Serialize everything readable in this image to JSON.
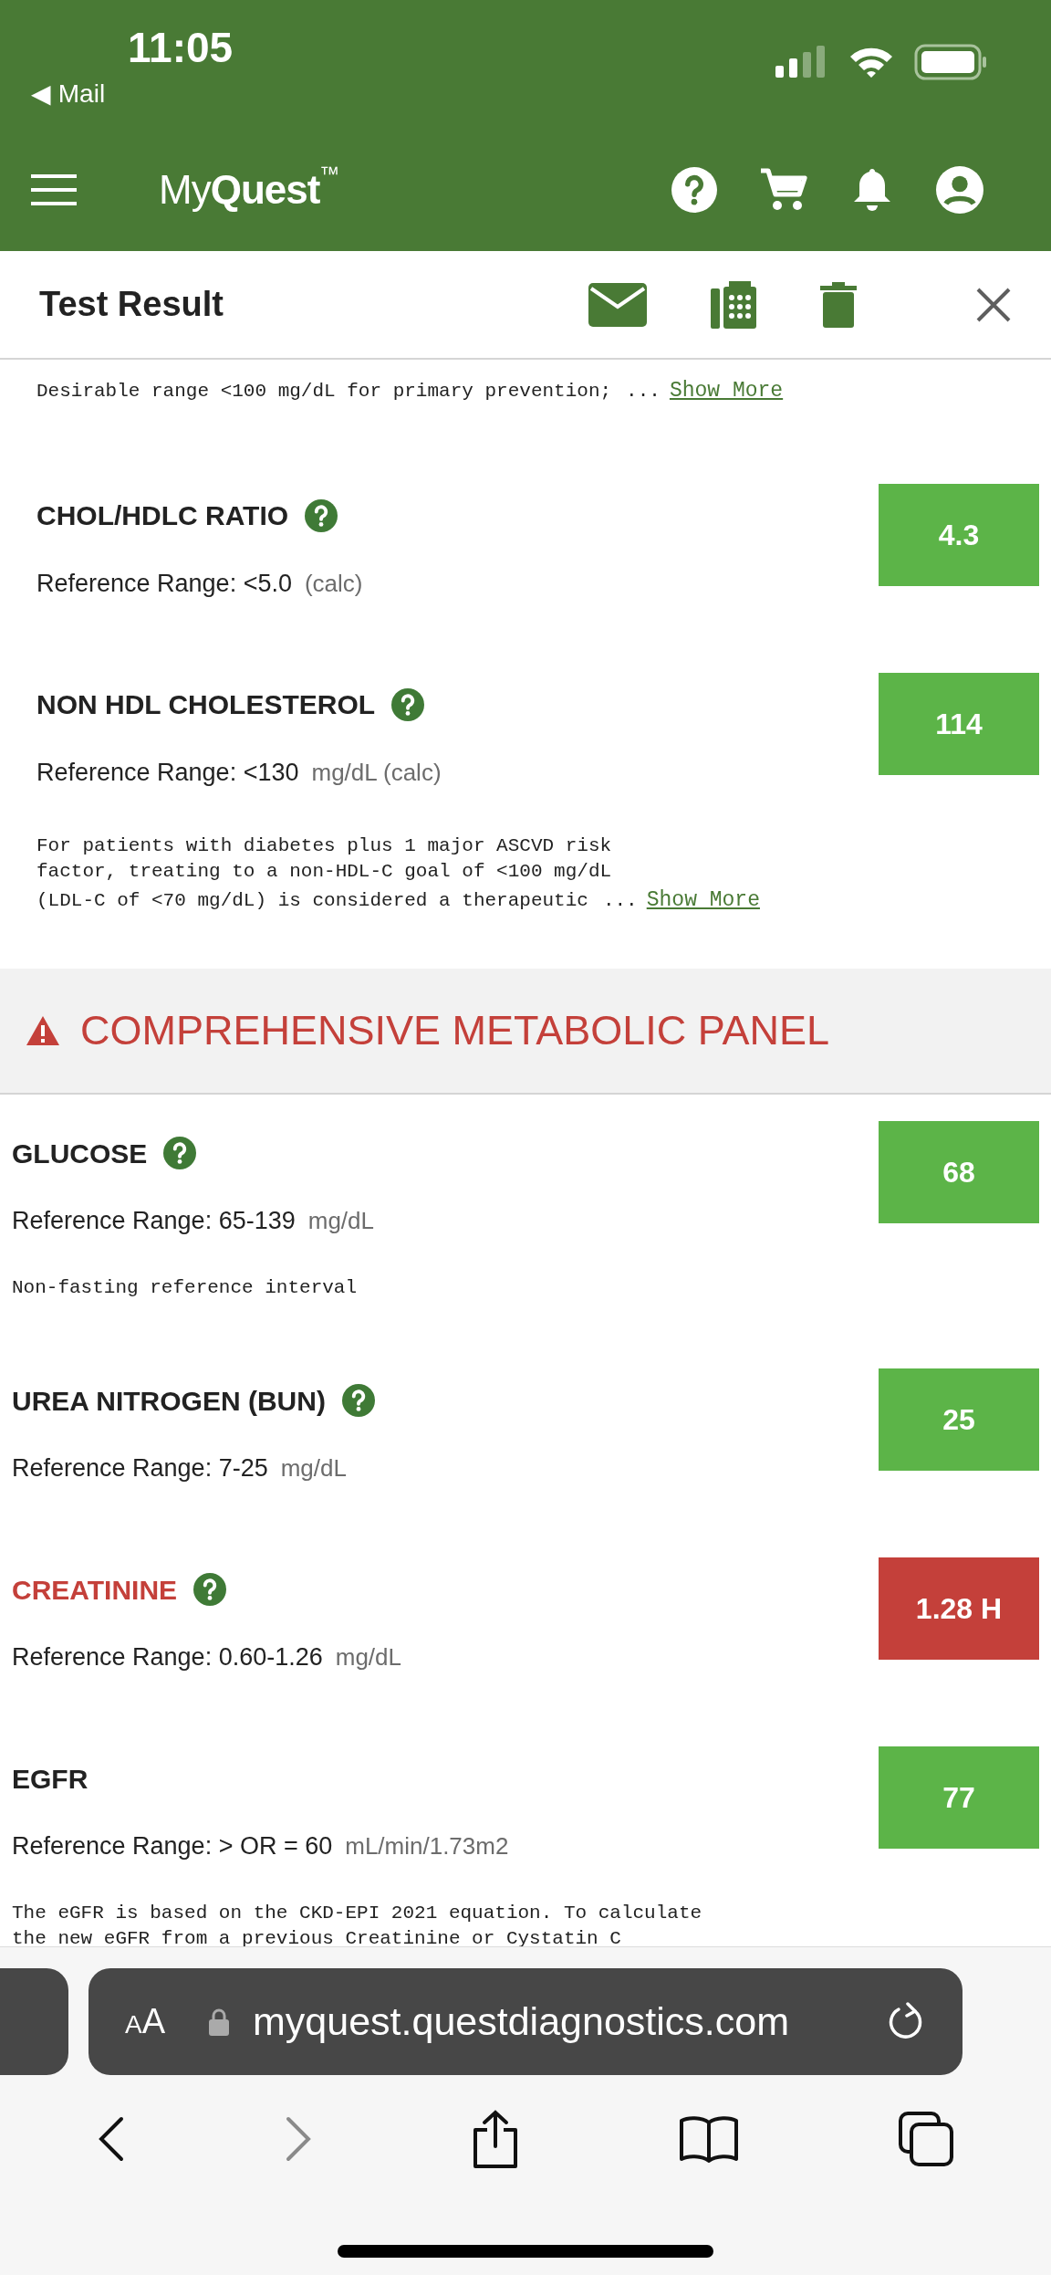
{
  "status_bar": {
    "time": "11:05",
    "back_app": "◀ Mail"
  },
  "app_header": {
    "logo": "My**Quest**$^{™}$"
  },
  "title_bar": {
    "title": "Test Result"
  },
  "sections": [
    {
      "intro_note": {
        "text": "Desirable range <100 mg/dL for primary prevention;",
        "ellipsis": "...",
        "link": "Show More"
      },
      "results": [
        {
          "name": "CHOL/HDLC RATIO",
          "help": true,
          "abnormal": false,
          "value": "4.3",
          "reference": "Reference Range: <5.0",
          "units": "(calc)"
        },
        {
          "name": "NON HDL CHOLESTEROL",
          "help": true,
          "abnormal": false,
          "value": "114",
          "reference": "Reference Range: <130",
          "units": "mg/dL (calc)",
          "note": {
            "text": "For patients with diabetes plus 1 major ASCVD risk\nfactor, treating to a non-HDL-C goal of <100 mg/dL\n(LDL-C of <70 mg/dL) is considered a therapeutic",
            "ellipsis": "...",
            "link": "Show More"
          }
        }
      ]
    },
    {
      "heading": "COMPREHENSIVE METABOLIC PANEL",
      "warning": true,
      "results": [
        {
          "name": "GLUCOSE",
          "help": true,
          "abnormal": false,
          "value": "68",
          "reference": "Reference Range: 65-139",
          "units": "mg/dL",
          "note": {
            "text": "Non-fasting reference interval"
          }
        },
        {
          "name": "UREA NITROGEN (BUN)",
          "help": true,
          "abnormal": false,
          "value": "25",
          "reference": "Reference Range: 7-25",
          "units": "mg/dL"
        },
        {
          "name": "CREATININE",
          "help": true,
          "abnormal": true,
          "value": "1.28 H",
          "reference": "Reference Range: 0.60-1.26",
          "units": "mg/dL"
        },
        {
          "name": "EGFR",
          "help": false,
          "abnormal": false,
          "value": "77",
          "reference": "Reference Range: > OR = 60",
          "units": "mL/min/1.73m2",
          "note": {
            "text": "The eGFR is based on the CKD-EPI 2021 equation. To calculate\nthe new eGFR from a previous Creatinine or Cystatin C"
          }
        }
      ]
    }
  ],
  "browser": {
    "text_size": "AA",
    "url": "myquest.questdiagnostics.com"
  }
}
